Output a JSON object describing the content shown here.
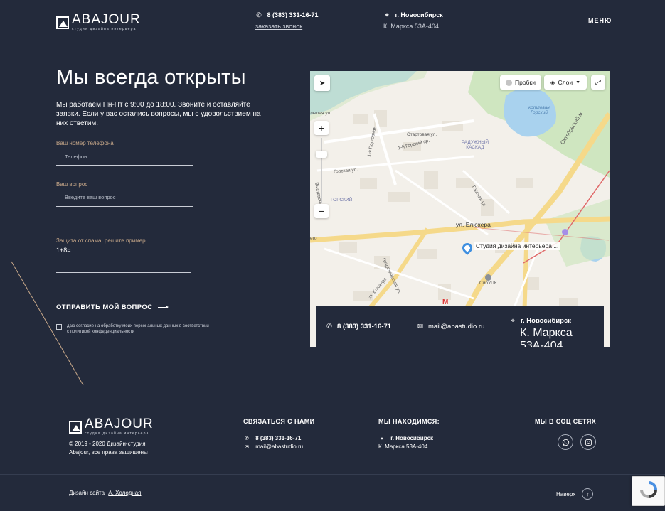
{
  "header": {
    "logo_text": "ABAJOUR",
    "logo_sub": "студия дизайна интерьера",
    "phone": "8 (383) 331-16-71",
    "callback_link": "заказать звонок",
    "city": "г. Новосибирск",
    "address": "К. Маркса 53А-404",
    "menu_label": "МЕНЮ"
  },
  "form": {
    "title": "Мы всегда открыты",
    "lead": "Мы работаем Пн-Пт с 9:00 до 18:00. Звоните и оставляйте заявки. Если у вас остались вопросы, мы с удовольствием на них ответим.",
    "phone_label": "Ваш номер телефона",
    "phone_placeholder": "Телефон",
    "question_label": "Ваш вопрос",
    "question_placeholder": "Введите ваш вопрос",
    "captcha_label": "Защита от спама, решите пример.",
    "captcha_expr": "1+8=",
    "submit_label": "ОТПРАВИТЬ МОЙ ВОПРОС",
    "consent_text": "даю согласие на обработку моих персональных данных в соответствии с политикой конфеденциальности"
  },
  "map": {
    "traffic_label": "Пробки",
    "layers_label": "Слои",
    "marker_label": "Студия дизайна интерьера ...",
    "streets": {
      "bluhera_main": "ул. Блюхера",
      "bluhera_side": "ул. Блюхера",
      "oktyabrsky": "Октябрьский м",
      "gorskaya": "Горская ул.",
      "gorskaya2": "Горская ул.",
      "startovaya": "Стартовая ул.",
      "gorskiy": "1-й Горский пр.",
      "podgorny": "1-я Подгорная",
      "vystavochnaya": "Выставочная ул.",
      "geodezicheskaya": "Геодезическая ул.",
      "sibupk": "СибУПК",
      "raduzhny": "РАДУЖНЫЙ КАСКАД",
      "gorsky_district": "ГОРСКИЙ",
      "lake": "котлован Горский",
      "lake_a": "котлован",
      "lake_b": "Горский",
      "ego": "его",
      "lshaya": "льшая ул."
    },
    "contact_bar": {
      "phone": "8 (383) 331-16-71",
      "email": "mail@abastudio.ru",
      "city": "г. Новосибирск",
      "address": "К. Маркса 53А-404"
    }
  },
  "footer": {
    "logo_text": "ABAJOUR",
    "logo_sub": "студия дизайна интерьера",
    "copyright_line1": "© 2019 - 2020 Дизайн-студия",
    "copyright_line2": "Abajour, все права защищены",
    "contact_title": "СВЯЗАТЬСЯ С НАМИ",
    "contact_phone": "8 (383) 331-16-71",
    "contact_email": "mail@abastudio.ru",
    "location_title": "МЫ НАХОДИМСЯ:",
    "location_city": "г. Новосибирск",
    "location_address": "К. Маркса 53А-404",
    "social_title": "МЫ В СОЦ СЕТЯХ",
    "social_icons": [
      "whatsapp-icon",
      "instagram-icon"
    ],
    "design_credit_prefix": "Дизайн сайта",
    "design_credit_author": "А. Холодная",
    "back_to_top": "Наверх"
  },
  "colors": {
    "background": "#232a3b",
    "accent_label": "#c9a98a",
    "map_road": "#f5d98a",
    "map_water": "#a9d2ee",
    "map_park": "#cfe6c0",
    "marker": "#3e8fe0"
  }
}
